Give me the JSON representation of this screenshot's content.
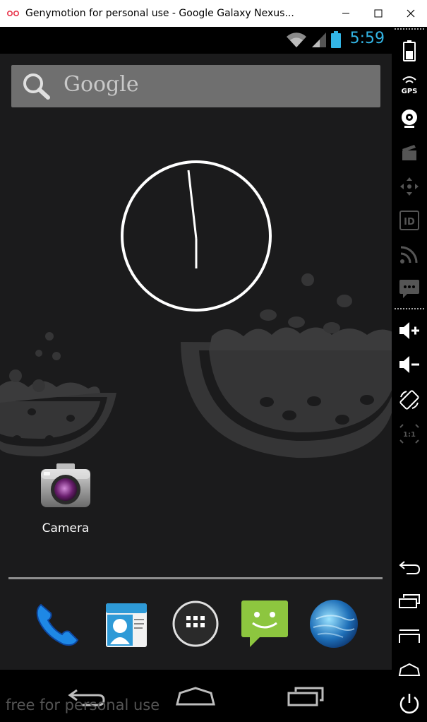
{
  "window": {
    "title": "Genymotion for personal use - Google Galaxy Nexus..."
  },
  "statusbar": {
    "time": "5:59"
  },
  "search": {
    "label": "Google"
  },
  "home": {
    "apps": [
      {
        "label": "Camera",
        "icon": "camera-icon"
      }
    ],
    "dock": [
      {
        "icon": "phone-icon"
      },
      {
        "icon": "contacts-icon"
      },
      {
        "icon": "app-drawer-icon"
      },
      {
        "icon": "messaging-icon"
      },
      {
        "icon": "browser-globe-icon"
      }
    ]
  },
  "watermark": "free for personal use",
  "sidebar": {
    "tools": [
      "battery-icon",
      "gps-icon",
      "webcam-icon",
      "capture-icon",
      "dpad-icon",
      "device-id-icon",
      "network-icon",
      "sms-icon",
      "volume-up-icon",
      "volume-down-icon",
      "rotate-icon",
      "pixel-perfect-icon",
      "back-icon",
      "recent-apps-icon",
      "menu-icon",
      "home-icon",
      "power-icon"
    ],
    "gps_label": "GPS",
    "id_label": "ID",
    "pixel_label": "1:1"
  },
  "colors": {
    "accent": "#33b5e5",
    "screen_bg": "#1b1b1c",
    "wallpaper_shape": "#3b3b3c"
  }
}
